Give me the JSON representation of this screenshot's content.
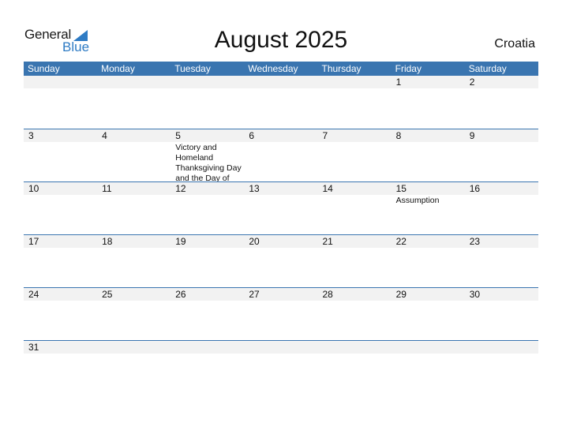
{
  "logo": {
    "line1": "General",
    "line2": "Blue"
  },
  "title": "August 2025",
  "country": "Croatia",
  "weekdays": [
    "Sunday",
    "Monday",
    "Tuesday",
    "Wednesday",
    "Thursday",
    "Friday",
    "Saturday"
  ],
  "weeks": [
    {
      "days": [
        "",
        "",
        "",
        "",
        "",
        "1",
        "2"
      ],
      "events": [
        "",
        "",
        "",
        "",
        "",
        "",
        ""
      ]
    },
    {
      "days": [
        "3",
        "4",
        "5",
        "6",
        "7",
        "8",
        "9"
      ],
      "events": [
        "",
        "",
        "Victory and Homeland Thanksgiving Day and the Day of",
        "",
        "",
        "",
        ""
      ]
    },
    {
      "days": [
        "10",
        "11",
        "12",
        "13",
        "14",
        "15",
        "16"
      ],
      "events": [
        "",
        "",
        "",
        "",
        "",
        "Assumption",
        ""
      ]
    },
    {
      "days": [
        "17",
        "18",
        "19",
        "20",
        "21",
        "22",
        "23"
      ],
      "events": [
        "",
        "",
        "",
        "",
        "",
        "",
        ""
      ]
    },
    {
      "days": [
        "24",
        "25",
        "26",
        "27",
        "28",
        "29",
        "30"
      ],
      "events": [
        "",
        "",
        "",
        "",
        "",
        "",
        ""
      ]
    },
    {
      "days": [
        "31",
        "",
        "",
        "",
        "",
        "",
        ""
      ],
      "events": [
        "",
        "",
        "",
        "",
        "",
        "",
        ""
      ]
    }
  ],
  "colors": {
    "header": "#3a75b0",
    "band": "#f2f2f2",
    "brand_blue": "#2e7bc4"
  }
}
